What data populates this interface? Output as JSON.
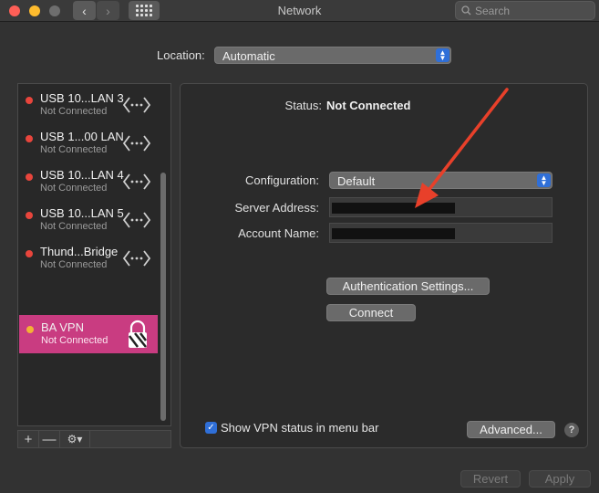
{
  "window": {
    "title": "Network"
  },
  "search": {
    "placeholder": "Search"
  },
  "location": {
    "label": "Location:",
    "value": "Automatic"
  },
  "services": [
    {
      "name": "USB 10...LAN 3",
      "status": "Not Connected",
      "icon": "ethernet-arrows-icon"
    },
    {
      "name": "USB 1...00 LAN",
      "status": "Not Connected",
      "icon": "ethernet-arrows-icon"
    },
    {
      "name": "USB 10...LAN 4",
      "status": "Not Connected",
      "icon": "ethernet-arrows-icon"
    },
    {
      "name": "USB 10...LAN 5",
      "status": "Not Connected",
      "icon": "ethernet-arrows-icon"
    },
    {
      "name": "Thund...Bridge",
      "status": "Not Connected",
      "icon": "ethernet-arrows-icon"
    },
    {
      "name": "BA VPN",
      "status": "Not Connected",
      "icon": "vpn-lock-icon",
      "selected": true
    }
  ],
  "sidebar_footer": {
    "add": "+",
    "remove": "—",
    "gear": "⚙▾"
  },
  "detail": {
    "status_label": "Status:",
    "status_value": "Not Connected",
    "configuration_label": "Configuration:",
    "configuration_value": "Default",
    "server_address_label": "Server Address:",
    "account_name_label": "Account Name:",
    "auth_button": "Authentication Settings...",
    "connect_button": "Connect",
    "show_vpn_label": "Show VPN status in menu bar",
    "show_vpn_checked": true,
    "advanced_button": "Advanced...",
    "help": "?"
  },
  "footer": {
    "revert": "Revert",
    "apply": "Apply"
  },
  "colors": {
    "selected_row": "#c93c81",
    "status_red": "#e8453c",
    "status_yellow": "#f3b235",
    "accent_blue": "#2f6fd8",
    "annotation_arrow": "#e8402a"
  }
}
